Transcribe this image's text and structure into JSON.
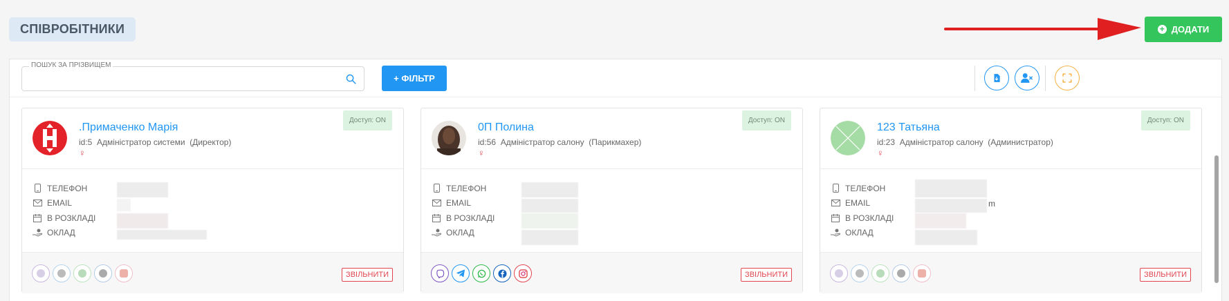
{
  "header": {
    "title": "СПІВРОБІТНИКИ",
    "add_label": "ДОДАТИ"
  },
  "colors": {
    "accent": "#2196f3",
    "add_green": "#34c65c",
    "danger": "#e2454f",
    "arrow": "#e02020"
  },
  "toolbar": {
    "search_label": "ПОШУК ЗА ПРІЗВИЩЕМ",
    "search_value": "",
    "filter_label": "+ ФІЛЬТР",
    "icons": [
      "download-icon",
      "user-remove-icon",
      "fullscreen-icon"
    ]
  },
  "labels": {
    "phone": "ТЕЛЕФОН",
    "email": "EMAIL",
    "schedule": "В РОЗКЛАДІ",
    "salary": "ОКЛАД",
    "fire": "ЗВІЛЬНИТИ",
    "gender_symbol": "♀"
  },
  "employees": [
    {
      "name": ".Примаченко Марія",
      "meta": "id:5  Адміністратор системи  (Директор)",
      "access": "Доступ: ON",
      "avatar": "red-logo",
      "email_tail": "",
      "social_active": false
    },
    {
      "name": "0П Полина",
      "meta": "id:56  Адміністратор салону  (Парикмахер)",
      "access": "Доступ: ON",
      "avatar": "photo",
      "email_tail": "",
      "social_active": true
    },
    {
      "name": "123 Татьяна",
      "meta": "id:23  Адміністратор салону  (Администратор)",
      "access": "Доступ: ON",
      "avatar": "placeholder-x",
      "email_tail": "m",
      "social_active": false
    }
  ],
  "social": [
    "viber-icon",
    "telegram-icon",
    "whatsapp-icon",
    "facebook-icon",
    "instagram-icon"
  ]
}
